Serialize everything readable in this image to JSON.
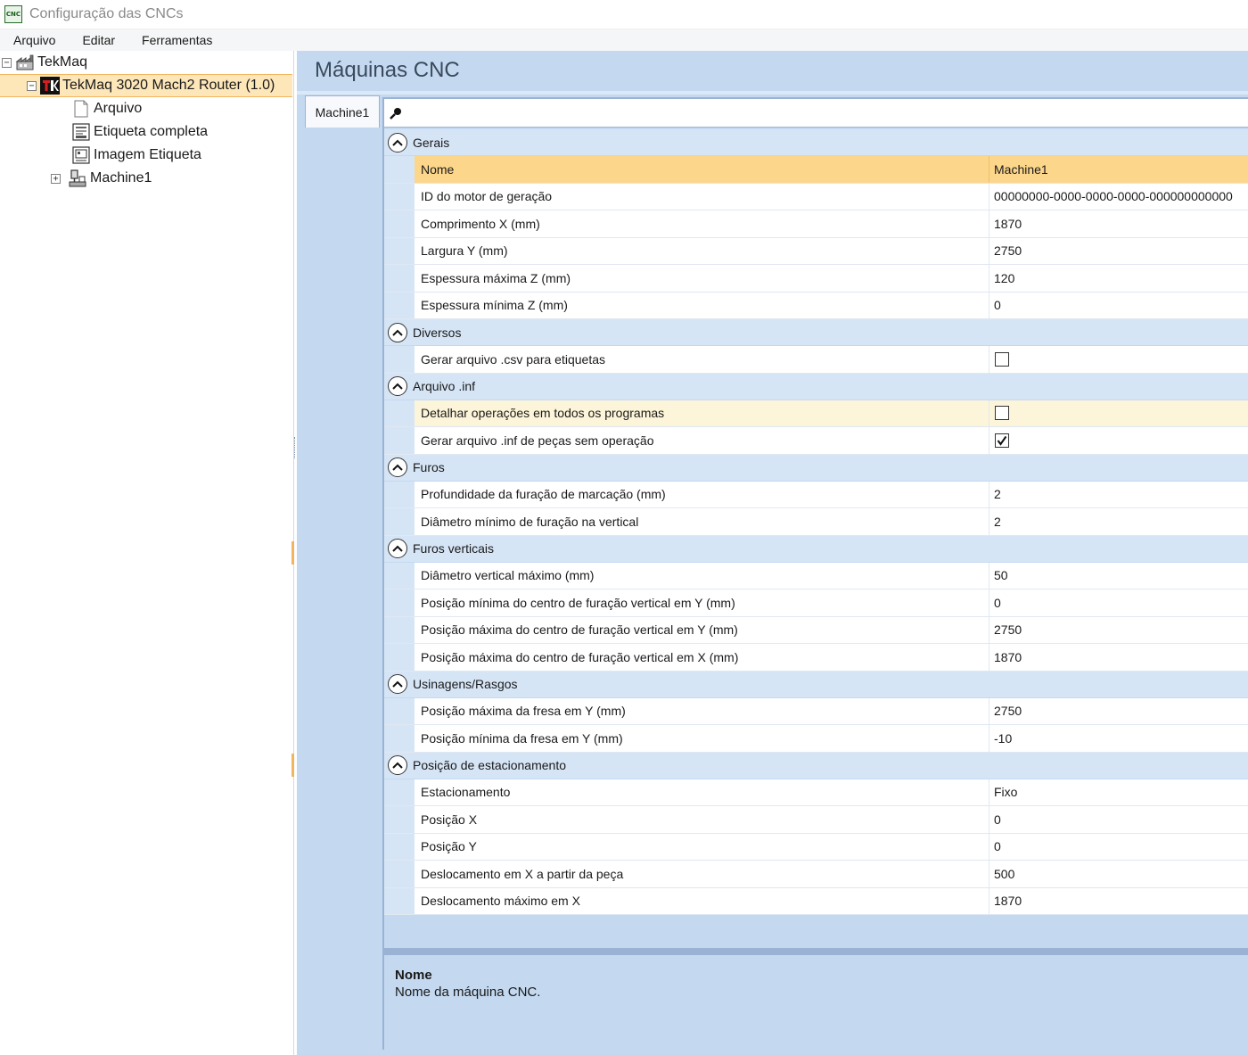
{
  "window": {
    "app_icon": "CNC",
    "title": "Configuração das CNCs"
  },
  "menu": [
    "Arquivo",
    "Editar",
    "Ferramentas"
  ],
  "tree": {
    "root": "TekMaq",
    "machine": "TekMaq 3020 Mach2 Router (1.0)",
    "children": [
      "Arquivo",
      "Etiqueta completa",
      "Imagem Etiqueta",
      "Machine1"
    ]
  },
  "header": {
    "title": "Máquinas CNC"
  },
  "tab": {
    "label": "Machine1"
  },
  "grid": {
    "categories": [
      {
        "name": "Gerais",
        "rows": [
          {
            "name": "Nome",
            "value": "Machine1"
          },
          {
            "name": "ID do motor de geração",
            "value": "00000000-0000-0000-0000-000000000000"
          },
          {
            "name": "Comprimento X (mm)",
            "value": "1870"
          },
          {
            "name": "Largura Y (mm)",
            "value": "2750"
          },
          {
            "name": "Espessura máxima Z (mm)",
            "value": "120"
          },
          {
            "name": "Espessura mínima Z (mm)",
            "value": "0"
          }
        ]
      },
      {
        "name": "Diversos",
        "rows": [
          {
            "name": "Gerar arquivo .csv para etiquetas",
            "checked": false
          }
        ]
      },
      {
        "name": "Arquivo .inf",
        "rows": [
          {
            "name": "Detalhar operações em todos os programas",
            "checked": false
          },
          {
            "name": "Gerar arquivo .inf de peças sem operação",
            "checked": true
          }
        ]
      },
      {
        "name": "Furos",
        "rows": [
          {
            "name": "Profundidade da furação de marcação (mm)",
            "value": "2"
          },
          {
            "name": "Diâmetro mínimo de furação na vertical",
            "value": "2"
          }
        ]
      },
      {
        "name": "Furos verticais",
        "rows": [
          {
            "name": "Diâmetro vertical máximo (mm)",
            "value": "50"
          },
          {
            "name": "Posição mínima do centro de furação vertical em Y (mm)",
            "value": "0"
          },
          {
            "name": "Posição máxima do centro de furação vertical em Y (mm)",
            "value": "2750"
          },
          {
            "name": "Posição máxima do centro de furação vertical em X (mm)",
            "value": "1870"
          }
        ]
      },
      {
        "name": "Usinagens/Rasgos",
        "rows": [
          {
            "name": "Posição máxima da fresa em Y (mm)",
            "value": "2750"
          },
          {
            "name": "Posição mínima da fresa em Y (mm)",
            "value": "-10"
          }
        ]
      },
      {
        "name": "Posição de estacionamento",
        "rows": [
          {
            "name": "Estacionamento",
            "value": "Fixo"
          },
          {
            "name": "Posição X",
            "value": "0"
          },
          {
            "name": "Posição Y",
            "value": "0"
          },
          {
            "name": "Deslocamento em X a partir da peça",
            "value": "500"
          },
          {
            "name": "Deslocamento máximo em X",
            "value": "1870"
          }
        ]
      }
    ]
  },
  "description": {
    "title": "Nome",
    "text": "Nome da máquina CNC."
  },
  "colors": {
    "selected_row": "#fcd68a",
    "hover_row": "#fdf5d9",
    "panel_blue": "#c4d9f0",
    "category_blue": "#d6e5f6"
  }
}
